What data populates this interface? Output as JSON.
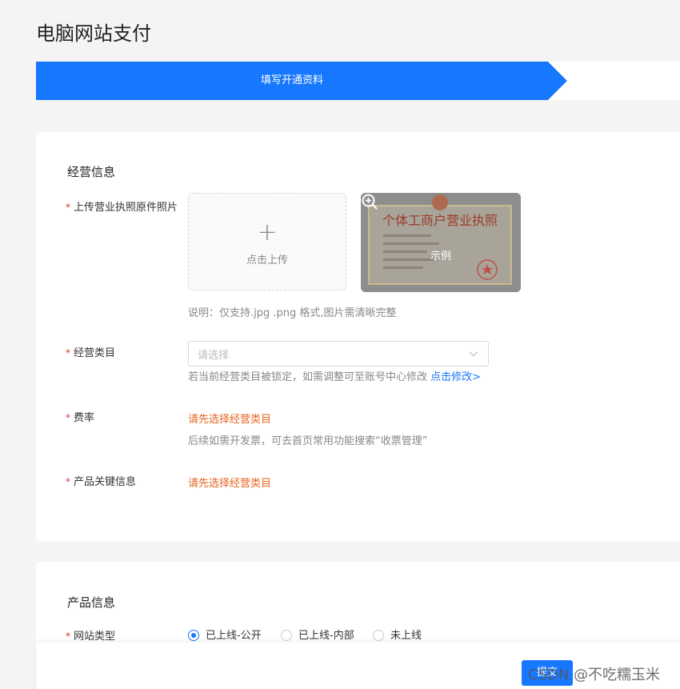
{
  "page": {
    "title": "电脑网站支付"
  },
  "steps": [
    {
      "label": "填写开通资料",
      "active": true
    }
  ],
  "business": {
    "section_title": "经营信息",
    "upload": {
      "label": "上传营业执照原件照片",
      "button_text": "点击上传",
      "example_text": "示例",
      "example_cert_title": "个体工商户营业执照",
      "note": "说明：仅支持.jpg .png 格式,图片需清晰完整"
    },
    "category": {
      "label": "经营类目",
      "placeholder": "请选择",
      "hint": "若当前经营类目被锁定，如需调整可至账号中心修改",
      "link": "点击修改>"
    },
    "fee": {
      "label": "费率",
      "warning": "请先选择经营类目",
      "hint": "后续如需开发票，可去首页常用功能搜索“收票管理”"
    },
    "keyinfo": {
      "label": "产品关键信息",
      "warning": "请先选择经营类目"
    }
  },
  "product": {
    "section_title": "产品信息",
    "site_type": {
      "label": "网站类型",
      "options": [
        "已上线-公开",
        "已上线-内部",
        "未上线"
      ],
      "selected": "已上线-公开"
    }
  },
  "footer": {
    "submit_label": "提交"
  },
  "watermark": "CSDN @不吃糯玉米",
  "colors": {
    "primary": "#1677ff",
    "warning": "#e8631d",
    "required": "#e0322b"
  }
}
